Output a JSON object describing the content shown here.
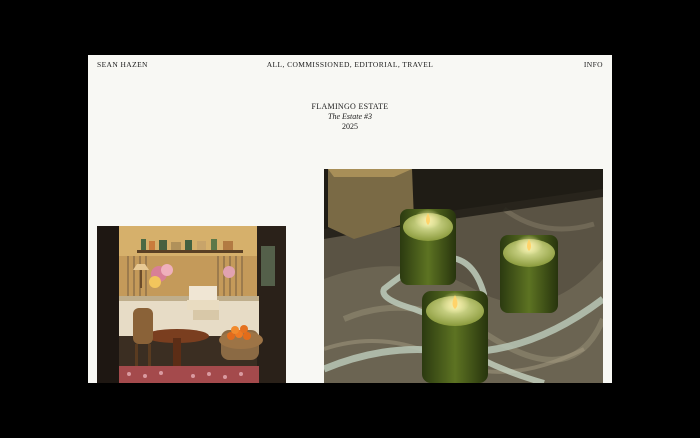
{
  "site": {
    "name": "SEAN HAZEN",
    "info_link": "INFO"
  },
  "nav": {
    "filters": [
      "ALL",
      "COMMISSIONED",
      "EDITORIAL",
      "TRAVEL"
    ],
    "separator": ", "
  },
  "project": {
    "client": "FLAMINGO ESTATE",
    "title": "The Estate #3",
    "year": "2025"
  },
  "colors": {
    "page_background": "#000000",
    "frame_background": "#f8f8f4",
    "text": "#1b1b1b"
  },
  "images": [
    {
      "name": "shop-interior-photo",
      "subject": "shop interior with table and oranges"
    },
    {
      "name": "candles-photo",
      "subject": "three lit green candles on marble"
    }
  ]
}
